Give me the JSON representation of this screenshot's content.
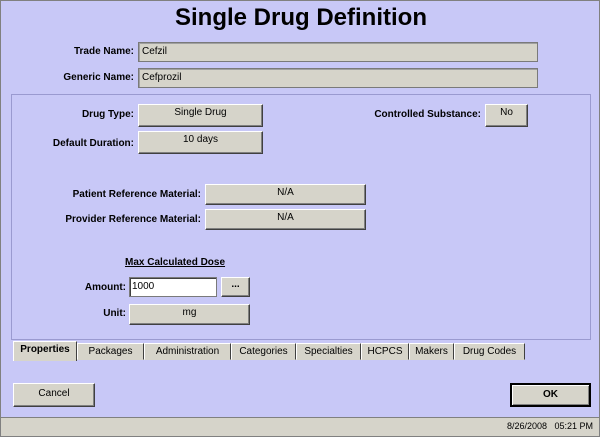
{
  "window": {
    "title": "Single Drug Definition"
  },
  "header": {
    "trade_name_label": "Trade Name:",
    "trade_name_value": "Cefzil",
    "generic_name_label": "Generic Name:",
    "generic_name_value": "Cefprozil"
  },
  "properties": {
    "drug_type_label": "Drug Type:",
    "drug_type_value": "Single Drug",
    "controlled_label": "Controlled Substance:",
    "controlled_value": "No",
    "default_duration_label": "Default Duration:",
    "default_duration_value": "10 days",
    "patient_ref_label": "Patient Reference Material:",
    "patient_ref_value": "N/A",
    "provider_ref_label": "Provider Reference Material:",
    "provider_ref_value": "N/A",
    "max_dose_heading": "Max Calculated Dose",
    "amount_label": "Amount:",
    "amount_value": "1000",
    "amount_browse_label": "...",
    "unit_label": "Unit:",
    "unit_value": "mg"
  },
  "tabs": [
    {
      "label": "Properties",
      "active": true
    },
    {
      "label": "Packages"
    },
    {
      "label": "Administration"
    },
    {
      "label": "Categories"
    },
    {
      "label": "Specialties"
    },
    {
      "label": "HCPCS"
    },
    {
      "label": "Makers"
    },
    {
      "label": "Drug Codes"
    }
  ],
  "footer": {
    "cancel_label": "Cancel",
    "ok_label": "OK"
  },
  "status": {
    "datetime": "8/26/2008   05:21 PM"
  },
  "colors": {
    "background": "#c8c8f7",
    "control_face": "#d6d4ca"
  }
}
